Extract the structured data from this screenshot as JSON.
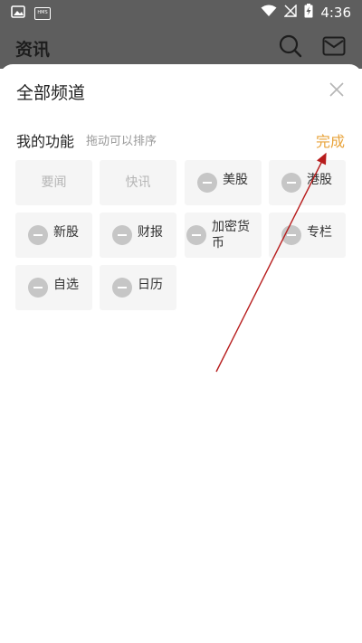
{
  "status_bar": {
    "time": "4:36",
    "hms_label": "HMS"
  },
  "app": {
    "title": "资讯"
  },
  "sheet": {
    "title": "全部频道",
    "section_title": "我的功能",
    "section_hint": "拖动可以排序",
    "done_label": "完成",
    "tiles": [
      {
        "label": "要闻",
        "removable": false
      },
      {
        "label": "快讯",
        "removable": false
      },
      {
        "label": "美股",
        "removable": true
      },
      {
        "label": "港股",
        "removable": true
      },
      {
        "label": "新股",
        "removable": true
      },
      {
        "label": "财报",
        "removable": true
      },
      {
        "label": "加密货币",
        "removable": true
      },
      {
        "label": "专栏",
        "removable": true
      },
      {
        "label": "自选",
        "removable": true
      },
      {
        "label": "日历",
        "removable": true
      }
    ]
  },
  "annotation": {
    "arrow_color": "#b71c1c"
  },
  "colors": {
    "accent": "#e8a33a",
    "overlay": "#5e5e5e"
  }
}
